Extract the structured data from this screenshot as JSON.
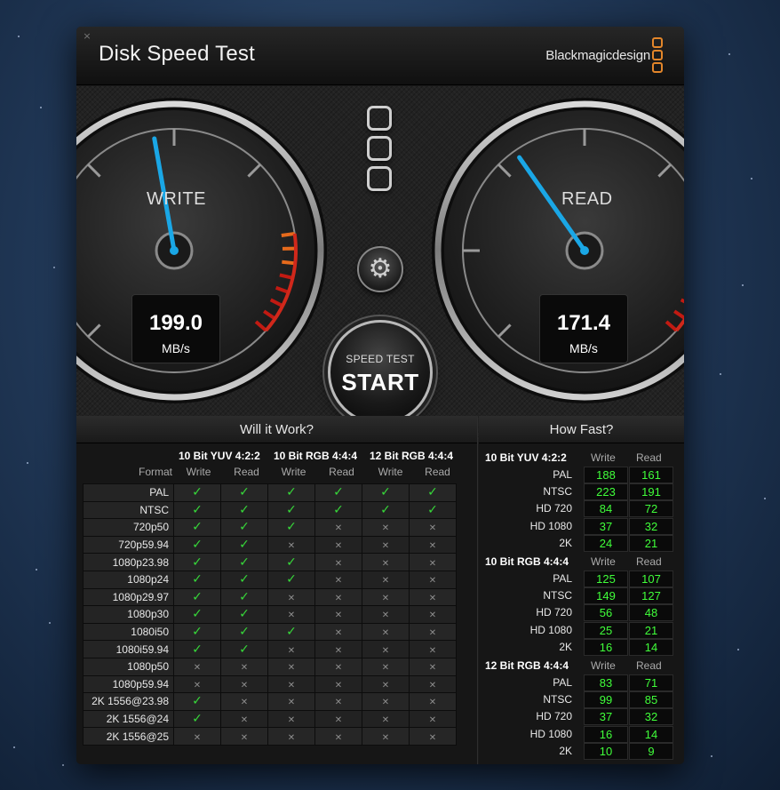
{
  "app": {
    "title": "Disk Speed Test",
    "brand": "Blackmagicdesign",
    "close_glyph": "×"
  },
  "gauges": {
    "write": {
      "label": "WRITE",
      "value": "199.0",
      "unit": "MB/s"
    },
    "read": {
      "label": "READ",
      "value": "171.4",
      "unit": "MB/s"
    }
  },
  "start_button": {
    "top_label": "SPEED TEST",
    "main_label": "START"
  },
  "settings_icon": "gear-icon",
  "will_it_work": {
    "title": "Will it Work?",
    "groups": [
      "10 Bit YUV 4:2:2",
      "10 Bit RGB 4:4:4",
      "12 Bit RGB 4:4:4"
    ],
    "format_header": "Format",
    "write_label": "Write",
    "read_label": "Read",
    "rows": [
      {
        "format": "PAL",
        "results": [
          1,
          1,
          1,
          1,
          1,
          1
        ]
      },
      {
        "format": "NTSC",
        "results": [
          1,
          1,
          1,
          1,
          1,
          1
        ]
      },
      {
        "format": "720p50",
        "results": [
          1,
          1,
          1,
          0,
          0,
          0
        ]
      },
      {
        "format": "720p59.94",
        "results": [
          1,
          1,
          0,
          0,
          0,
          0
        ]
      },
      {
        "format": "1080p23.98",
        "results": [
          1,
          1,
          1,
          0,
          0,
          0
        ]
      },
      {
        "format": "1080p24",
        "results": [
          1,
          1,
          1,
          0,
          0,
          0
        ]
      },
      {
        "format": "1080p29.97",
        "results": [
          1,
          1,
          0,
          0,
          0,
          0
        ]
      },
      {
        "format": "1080p30",
        "results": [
          1,
          1,
          0,
          0,
          0,
          0
        ]
      },
      {
        "format": "1080i50",
        "results": [
          1,
          1,
          1,
          0,
          0,
          0
        ]
      },
      {
        "format": "1080i59.94",
        "results": [
          1,
          1,
          0,
          0,
          0,
          0
        ]
      },
      {
        "format": "1080p50",
        "results": [
          0,
          0,
          0,
          0,
          0,
          0
        ]
      },
      {
        "format": "1080p59.94",
        "results": [
          0,
          0,
          0,
          0,
          0,
          0
        ]
      },
      {
        "format": "2K 1556@23.98",
        "results": [
          1,
          0,
          0,
          0,
          0,
          0
        ]
      },
      {
        "format": "2K 1556@24",
        "results": [
          1,
          0,
          0,
          0,
          0,
          0
        ]
      },
      {
        "format": "2K 1556@25",
        "results": [
          0,
          0,
          0,
          0,
          0,
          0
        ]
      }
    ]
  },
  "how_fast": {
    "title": "How Fast?",
    "write_label": "Write",
    "read_label": "Read",
    "groups": [
      {
        "name": "10 Bit YUV 4:2:2",
        "rows": [
          {
            "format": "PAL",
            "write": "188",
            "read": "161"
          },
          {
            "format": "NTSC",
            "write": "223",
            "read": "191"
          },
          {
            "format": "HD 720",
            "write": "84",
            "read": "72"
          },
          {
            "format": "HD 1080",
            "write": "37",
            "read": "32"
          },
          {
            "format": "2K",
            "write": "24",
            "read": "21"
          }
        ]
      },
      {
        "name": "10 Bit RGB 4:4:4",
        "rows": [
          {
            "format": "PAL",
            "write": "125",
            "read": "107"
          },
          {
            "format": "NTSC",
            "write": "149",
            "read": "127"
          },
          {
            "format": "HD 720",
            "write": "56",
            "read": "48"
          },
          {
            "format": "HD 1080",
            "write": "25",
            "read": "21"
          },
          {
            "format": "2K",
            "write": "16",
            "read": "14"
          }
        ]
      },
      {
        "name": "12 Bit RGB 4:4:4",
        "rows": [
          {
            "format": "PAL",
            "write": "83",
            "read": "71"
          },
          {
            "format": "NTSC",
            "write": "99",
            "read": "85"
          },
          {
            "format": "HD 720",
            "write": "37",
            "read": "32"
          },
          {
            "format": "HD 1080",
            "write": "16",
            "read": "14"
          },
          {
            "format": "2K",
            "write": "10",
            "read": "9"
          }
        ]
      }
    ]
  },
  "colors": {
    "accent_orange": "#e3862a",
    "needle_blue": "#1aa7e6",
    "value_green": "#40ff3a",
    "check_green": "#37d83a"
  }
}
